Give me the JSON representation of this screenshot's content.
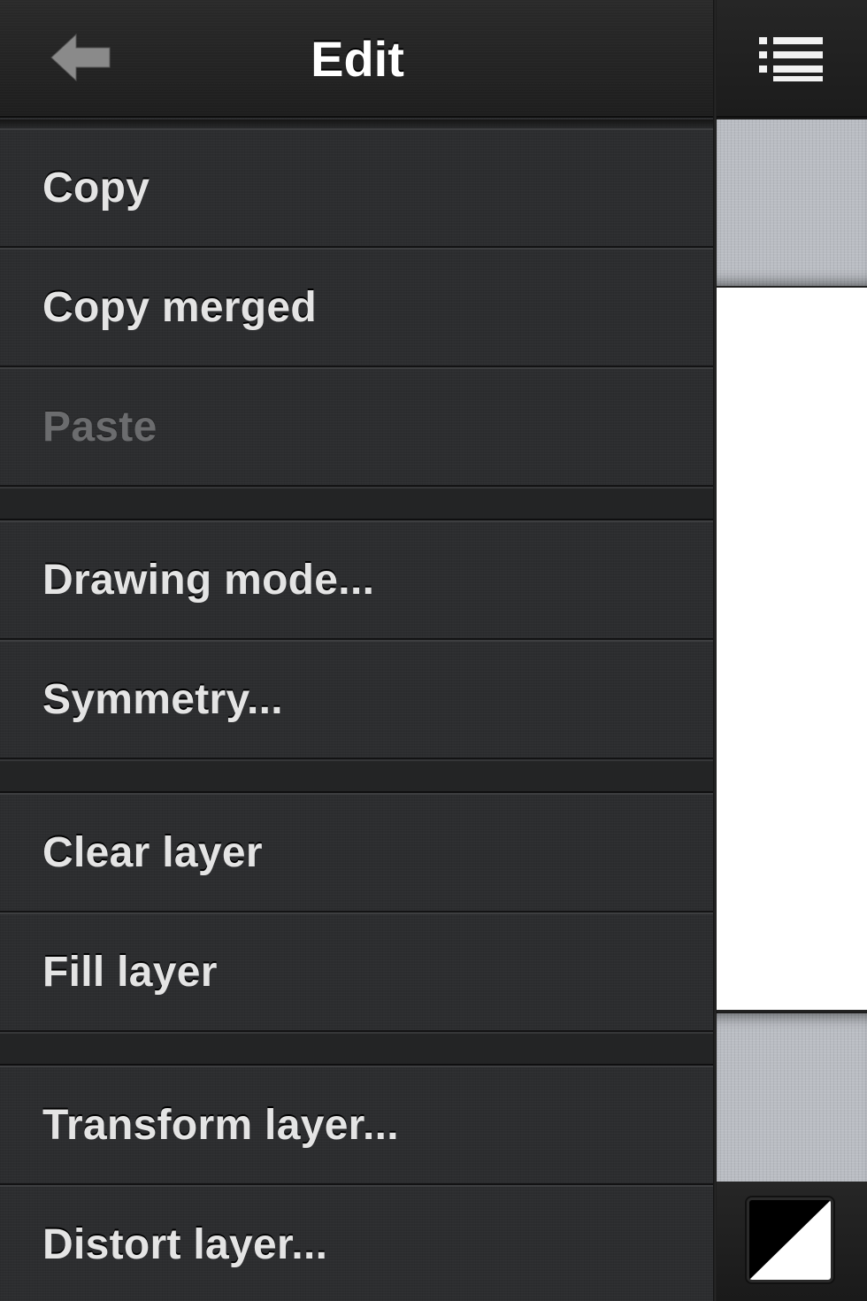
{
  "navbar": {
    "title": "Edit",
    "back_icon": "back-arrow-icon"
  },
  "menu": {
    "groups": [
      {
        "items": [
          {
            "label": "Copy",
            "enabled": true
          },
          {
            "label": "Copy merged",
            "enabled": true
          },
          {
            "label": "Paste",
            "enabled": false
          }
        ]
      },
      {
        "items": [
          {
            "label": "Drawing mode...",
            "enabled": true
          },
          {
            "label": "Symmetry...",
            "enabled": true
          }
        ]
      },
      {
        "items": [
          {
            "label": "Clear layer",
            "enabled": true
          },
          {
            "label": "Fill layer",
            "enabled": true
          }
        ]
      },
      {
        "items": [
          {
            "label": "Transform layer...",
            "enabled": true
          },
          {
            "label": "Distort layer...",
            "enabled": true
          }
        ]
      }
    ]
  },
  "right_panel": {
    "list_icon": "list-menu-icon",
    "canvas_color": "#ffffff",
    "swatch": {
      "primary": "#000000",
      "secondary": "#ffffff"
    }
  },
  "colors": {
    "panel_bg": "#2c2d2f",
    "text": "#e4e4e4",
    "disabled_text": "#6b6c6e",
    "linen": "#b9bcc2"
  }
}
